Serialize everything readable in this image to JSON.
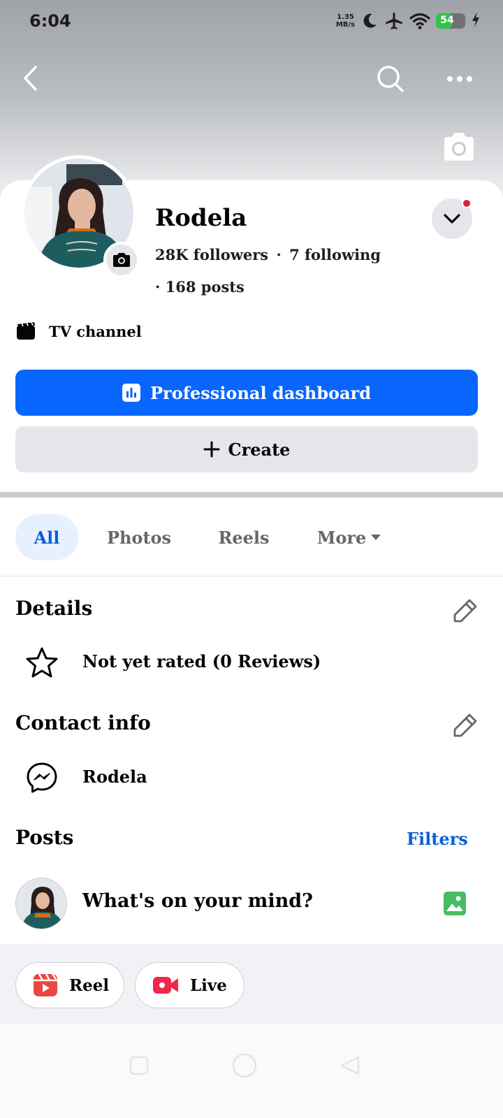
{
  "status_bar": {
    "time": "6:04",
    "net_speed_value": "1.35",
    "net_speed_unit": "MB/s",
    "battery_level": "54",
    "battery_color": "#35c24a"
  },
  "nav": {
    "back_icon": "back-arrow-icon",
    "search_icon": "search-icon",
    "more_icon": "more-dots-icon"
  },
  "profile": {
    "name": "Rodela",
    "followers": "28K followers",
    "separator": "·",
    "following": "7 following",
    "posts": "· 168 posts"
  },
  "category": {
    "label": "TV channel"
  },
  "actions": {
    "primary_label": "Professional dashboard",
    "primary_color": "#0866ff",
    "secondary_label": "Create"
  },
  "tabs": [
    {
      "label": "All",
      "active": true
    },
    {
      "label": "Photos",
      "active": false
    },
    {
      "label": "Reels",
      "active": false
    },
    {
      "label": "More",
      "active": false
    }
  ],
  "details": {
    "title": "Details",
    "rating_text": "Not yet rated (0 Reviews)"
  },
  "contact": {
    "title": "Contact info",
    "messenger_name": "Rodela"
  },
  "posts": {
    "title": "Posts",
    "filters_label": "Filters",
    "composer_placeholder": "What's on your mind?"
  },
  "quick_actions": {
    "reel_label": "Reel",
    "live_label": "Live"
  }
}
